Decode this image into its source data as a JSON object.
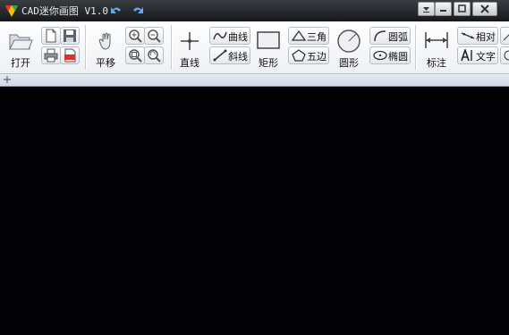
{
  "window": {
    "title": "CAD迷你画图 V1.0"
  },
  "toolbar": {
    "open_label": "打开",
    "pan_label": "平移",
    "line_label": "直线",
    "curve_label": "曲线",
    "slant_label": "斜线",
    "rect_label": "矩形",
    "triangle_label": "三角",
    "pentagon_label": "五边",
    "circle_label": "圆形",
    "arc_label": "圆弧",
    "ellipse_label": "椭圆",
    "dimension_label": "标注",
    "relative_label": "相对",
    "text_label": "文字"
  },
  "colors": {
    "canvas_bg": "#020103",
    "titlebar_bg": "#1e2024",
    "toolbar_bg": "#f3f5f8"
  }
}
